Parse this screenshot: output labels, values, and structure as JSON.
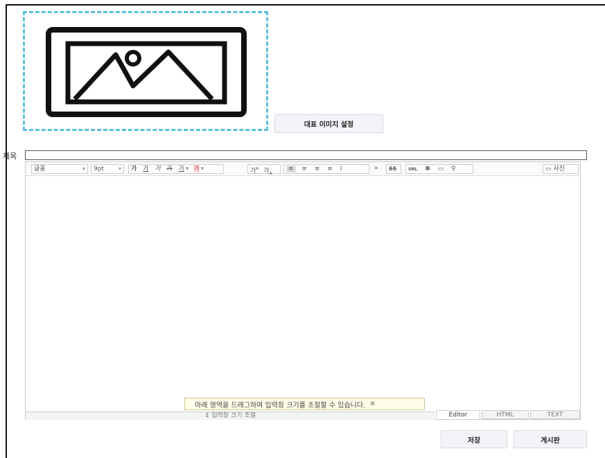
{
  "representative_image": {
    "icon": "image-placeholder-icon",
    "button_label": "대표 이미지 설정"
  },
  "title": {
    "label": "제목",
    "value": ""
  },
  "toolbar": {
    "font_select": "글꼴",
    "size_select": "9pt",
    "bold": "가",
    "underline": "가",
    "italic": "가",
    "strike": "가",
    "font_color": "가",
    "bg_color": "가",
    "superscript": "가",
    "subscript": "가",
    "more": "»",
    "quote": "66",
    "url": "URL",
    "photo_label": "사진"
  },
  "tooltip": {
    "text": "아래 영역을 드래그하여 입력창 크기를 조절할 수 있습니다.",
    "close": "✕"
  },
  "resize_bar": {
    "label": "⇕ 입력창 크기 조절"
  },
  "mode_tabs": [
    "Editor",
    "HTML",
    "TEXT"
  ],
  "actions": {
    "save": "저장",
    "post": "게시판"
  }
}
